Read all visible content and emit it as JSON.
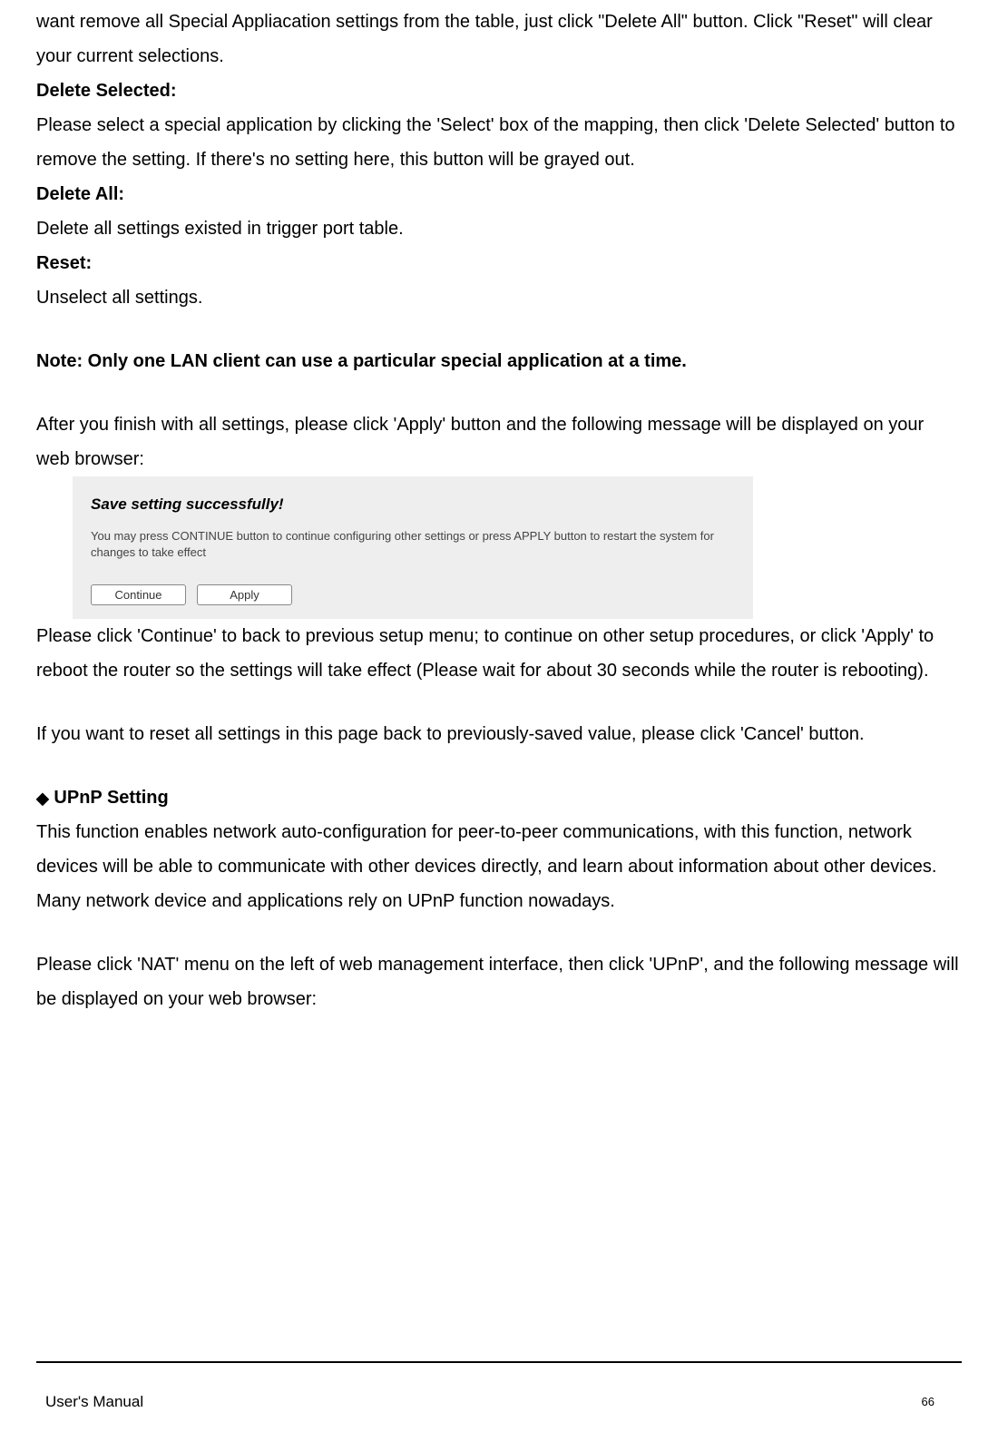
{
  "content": {
    "intro": "want remove all Special Appliacation settings from the table, just click \"Delete All\" button. Click \"Reset\" will clear your current selections.",
    "deleteSelectedLabel": "Delete Selected:",
    "deleteSelectedText": "Please select a special application by clicking the 'Select' box of the mapping, then click 'Delete Selected' button to remove the setting. If there's no setting here, this button will be grayed out.",
    "deleteAllLabel": "Delete All:",
    "deleteAllText": "Delete all settings existed in trigger port table.",
    "resetLabel": "Reset:",
    "resetText": "Unselect all settings.",
    "note": "Note: Only one LAN client can use a particular special application at a time.",
    "afterFinish": "After you finish with all settings, please click 'Apply' button and the following message will be displayed on your web browser:",
    "dialog": {
      "title": "Save setting successfully!",
      "text": "You may press CONTINUE button to continue configuring other settings or press APPLY button to restart the system for changes to take effect",
      "continueLabel": "Continue",
      "applyLabel": "Apply"
    },
    "continueText": "Please click 'Continue' to back to previous setup menu; to continue on other setup procedures, or click 'Apply' to reboot the router so the settings will take effect (Please wait for about 30 seconds while the router is rebooting).",
    "cancelText": "If you want to reset all settings in this page back to previously-saved value, please click 'Cancel' button.",
    "upnpHeading": "UPnP Setting",
    "upnpText": "This function enables network auto-configuration for peer-to-peer communications, with this function, network devices will be able to communicate with other devices directly, and learn about information about other devices. Many network device and applications rely on UPnP function nowadays.",
    "upnpNav": "Please click 'NAT' menu on the left of web management interface, then click 'UPnP', and the following message will be displayed on your web browser:"
  },
  "footer": {
    "title": "User's Manual",
    "page": "66"
  }
}
